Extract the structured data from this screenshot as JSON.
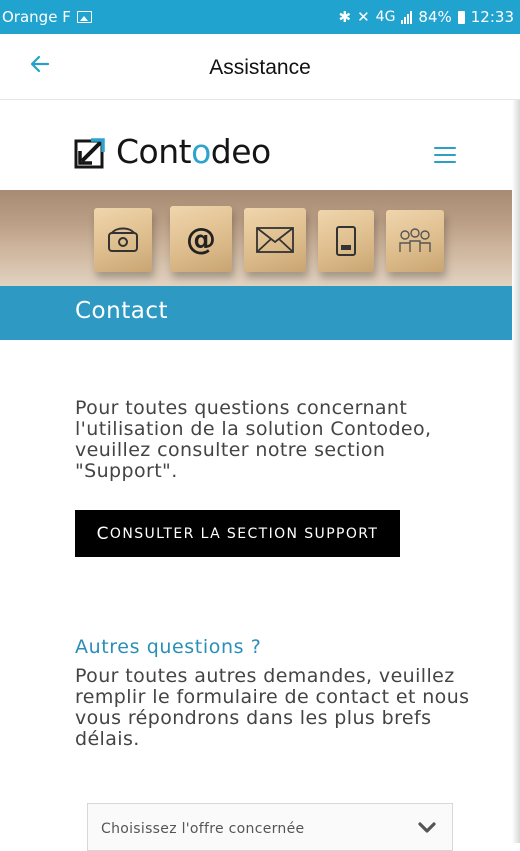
{
  "status_bar": {
    "carrier": "Orange F",
    "network": "4G",
    "battery": "84%",
    "time": "12:33",
    "icons": [
      "image-icon",
      "bluetooth-icon",
      "mute-icon",
      "signal-icon",
      "battery-icon"
    ]
  },
  "app_bar": {
    "title": "Assistance",
    "back_icon": "back-arrow-icon"
  },
  "header": {
    "logo_prefix": "Cont",
    "logo_highlight": "o",
    "logo_suffix": "deo",
    "menu_icon": "hamburger-menu-icon"
  },
  "banner": {
    "icons": [
      "telephone-icon",
      "at-sign-icon",
      "envelope-icon",
      "mobile-phone-icon",
      "people-icon"
    ]
  },
  "section": {
    "title": "Contact",
    "intro": "Pour toutes questions concernant l'utilisation de la solution Contodeo, veuillez consulter notre section \"Support\".",
    "support_button_first": "C",
    "support_button_rest": "ONSULTER LA SECTION SUPPORT"
  },
  "other": {
    "heading": "Autres questions ?",
    "text": "Pour toutes autres demandes, veuillez remplir le formulaire de contact et nous vous répondrons dans les plus brefs délais.",
    "select_placeholder": "Choisissez l'offre concernée"
  },
  "colors": {
    "status_bar": "#21a3cf",
    "accent": "#2e9ac3",
    "button": "#000000"
  }
}
